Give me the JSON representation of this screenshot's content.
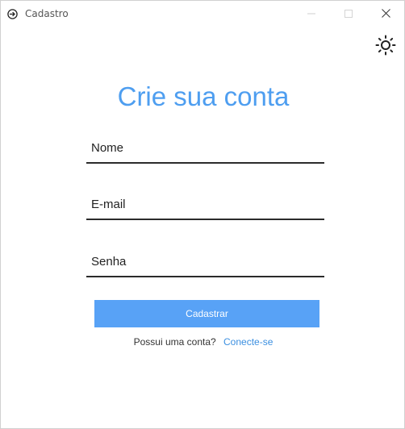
{
  "window": {
    "title": "Cadastro",
    "controls": {
      "minimize": "minimize",
      "maximize": "maximize",
      "close": "close"
    }
  },
  "header": {
    "theme_toggle_icon": "sun-icon"
  },
  "form": {
    "heading": "Crie sua conta",
    "fields": [
      {
        "placeholder": "Nome",
        "value": ""
      },
      {
        "placeholder": "E-mail",
        "value": ""
      },
      {
        "placeholder": "Senha",
        "value": ""
      }
    ],
    "submit_label": "Cadastrar",
    "login_prompt": "Possui uma conta?",
    "login_link": "Conecte-se"
  },
  "colors": {
    "accent": "#4e9ef0",
    "button": "#58a2f6",
    "link": "#3b8fe0",
    "underline": "#2b2b2b"
  }
}
